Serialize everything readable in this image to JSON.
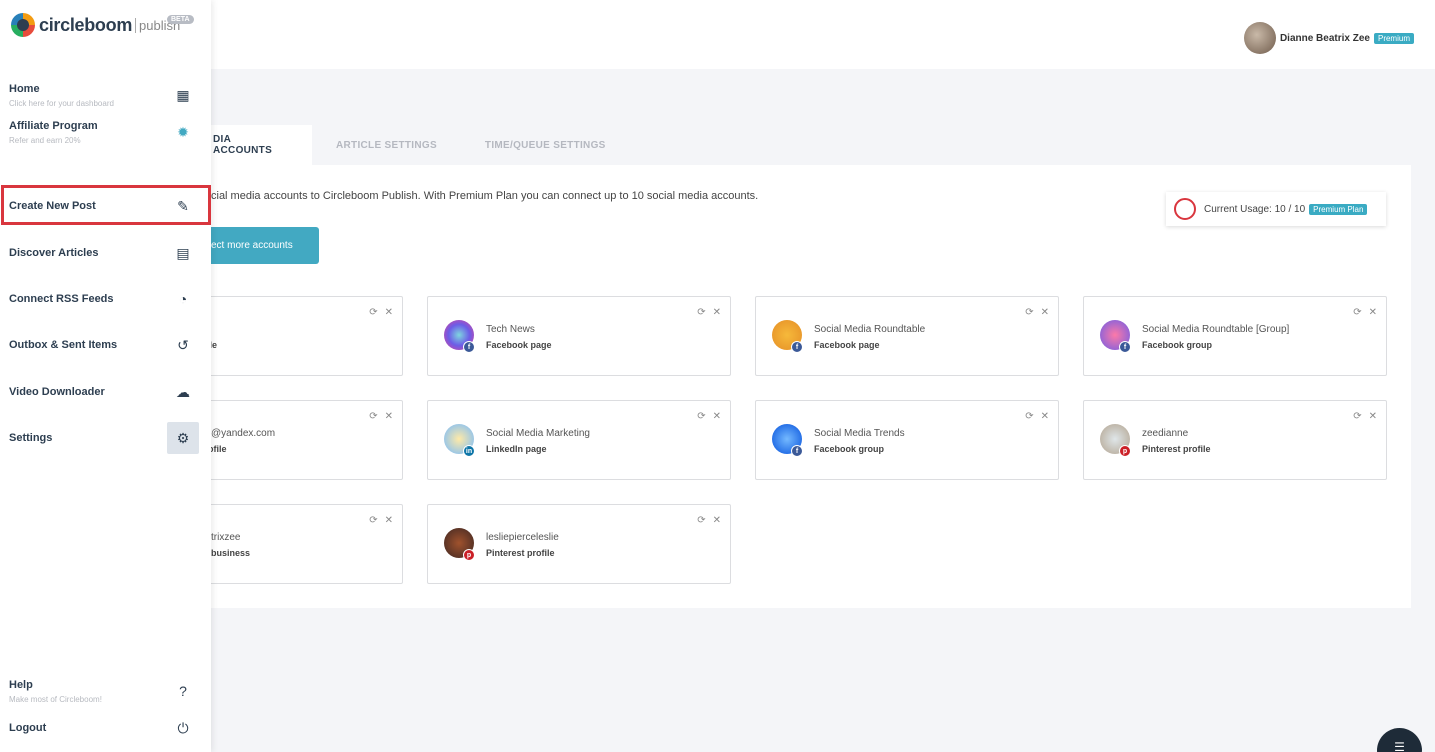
{
  "app": {
    "brand": "circleboom",
    "sub": "publish",
    "beta": "BETA"
  },
  "user": {
    "name": "Dianne Beatrix Zee",
    "plan_badge": "Premium"
  },
  "sidebar": {
    "items": [
      {
        "label": "Home",
        "hint": "Click here for your dashboard",
        "icon": "grid-icon"
      },
      {
        "label": "Affiliate Program",
        "hint": "Refer and earn 20%",
        "icon": "dollar-badge-icon"
      },
      {
        "label": "Create New Post",
        "icon": "edit-icon"
      },
      {
        "label": "Discover Articles",
        "icon": "newspaper-icon"
      },
      {
        "label": "Connect RSS Feeds",
        "icon": "rss-icon"
      },
      {
        "label": "Outbox & Sent Items",
        "icon": "history-icon"
      },
      {
        "label": "Video Downloader",
        "icon": "cloud-download-icon"
      },
      {
        "label": "Settings",
        "icon": "gears-icon"
      },
      {
        "label": "Help",
        "hint": "Make most of Circleboom!",
        "icon": "question-icon"
      },
      {
        "label": "Logout",
        "icon": "power-icon"
      }
    ]
  },
  "tabs": [
    "DIA ACCOUNTS",
    "ARTICLE SETTINGS",
    "TIME/QUEUE SETTINGS"
  ],
  "panel": {
    "intro": "cial media accounts to Circleboom Publish. With Premium Plan you can connect up to 10 social media accounts.",
    "connect_button": "ect more accounts",
    "usage": {
      "label": "Current Usage: 10 / 10",
      "badge": "Premium Plan"
    }
  },
  "accounts": [
    {
      "name": "",
      "type": "file",
      "network": "",
      "cut": true
    },
    {
      "name": "Tech News",
      "type": "Facebook page",
      "network": "fb"
    },
    {
      "name": "Social Media Roundtable",
      "type": "Facebook page",
      "network": "fb"
    },
    {
      "name": "Social Media Roundtable [Group]",
      "type": "Facebook group",
      "network": "fb"
    },
    {
      "name": "@yandex.com",
      "type": "ofile",
      "network": "",
      "cut": true
    },
    {
      "name": "Social Media Marketing",
      "type": "LinkedIn page",
      "network": "li"
    },
    {
      "name": "Social Media Trends",
      "type": "Facebook group",
      "network": "fb"
    },
    {
      "name": "zeedianne",
      "type": "Pinterest profile",
      "network": "pi"
    },
    {
      "name": "trixzee",
      "type": "business",
      "network": "",
      "cut": true
    },
    {
      "name": "lesliepierceleslie",
      "type": "Pinterest profile",
      "network": "pi"
    }
  ],
  "colors": {
    "accent": "#42a9c2",
    "highlight": "#d9363e",
    "navy": "#2d3e50"
  }
}
